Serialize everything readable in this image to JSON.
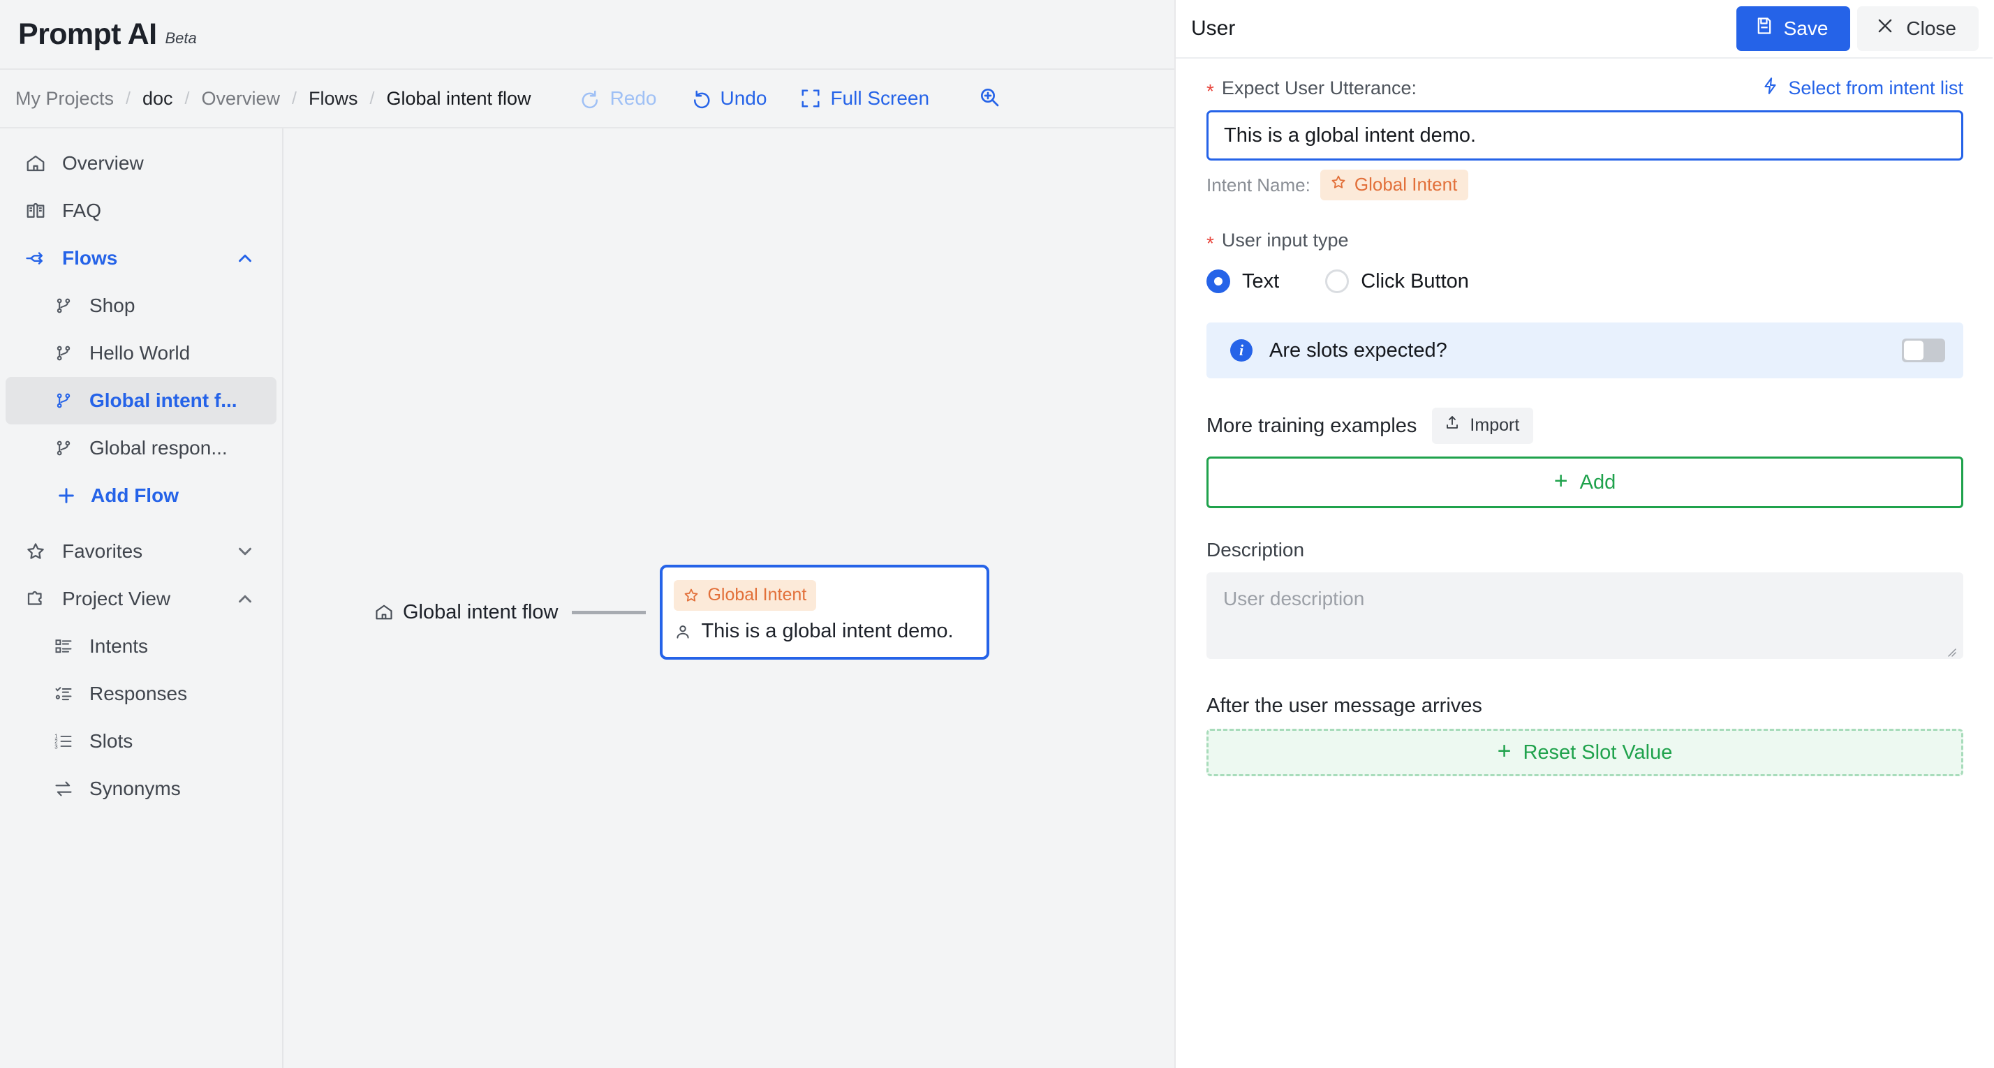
{
  "brand": {
    "name": "Prompt AI",
    "tag": "Beta"
  },
  "breadcrumb": {
    "items": [
      {
        "label": "My Projects"
      },
      {
        "label": "doc"
      },
      {
        "label": "Overview"
      },
      {
        "label": "Flows"
      },
      {
        "label": "Global intent flow"
      }
    ],
    "separator": "/"
  },
  "toolbar": {
    "redo_label": "Redo",
    "undo_label": "Undo",
    "fullscreen_label": "Full Screen",
    "zoom_icon": "zoom-in-icon"
  },
  "sidebar": {
    "items": [
      {
        "label": "Overview",
        "icon": "home-icon"
      },
      {
        "label": "FAQ",
        "icon": "book-icon"
      },
      {
        "label": "Flows",
        "icon": "flows-icon",
        "chevron": "chevron-up-icon"
      },
      {
        "label": "Shop",
        "icon": "branch-icon"
      },
      {
        "label": "Hello World",
        "icon": "branch-icon"
      },
      {
        "label": "Global intent f...",
        "icon": "branch-icon"
      },
      {
        "label": "Global respon...",
        "icon": "branch-icon"
      },
      {
        "label": "Add Flow",
        "icon": "plus-icon"
      },
      {
        "label": "Favorites",
        "icon": "star-icon",
        "chevron": "chevron-down-icon"
      },
      {
        "label": "Project View",
        "icon": "puzzle-icon",
        "chevron": "chevron-up-icon"
      },
      {
        "label": "Intents",
        "icon": "list-badge-icon"
      },
      {
        "label": "Responses",
        "icon": "list-check-icon"
      },
      {
        "label": "Slots",
        "icon": "list-number-icon"
      },
      {
        "label": "Synonyms",
        "icon": "swap-icon"
      }
    ]
  },
  "canvas": {
    "start_label": "Global intent flow",
    "start_icon": "home-icon",
    "node": {
      "badge": "Global Intent",
      "badge_icon": "star-icon",
      "utterance": "This is a global intent demo.",
      "utterance_icon": "user-icon"
    }
  },
  "panel": {
    "title": "User",
    "save_label": "Save",
    "save_icon": "save-icon",
    "close_label": "Close",
    "close_icon": "close-icon",
    "utterance_label": "Expect User Utterance:",
    "select_intent_label": "Select from intent list",
    "select_intent_icon": "lightning-icon",
    "utterance_value": "This is a global intent demo.",
    "intent_name_label": "Intent Name:",
    "intent_name_value": "Global Intent",
    "input_type_label": "User input type",
    "radio_text_label": "Text",
    "radio_button_label": "Click Button",
    "radio_selected": "Text",
    "slots_question": "Are slots expected?",
    "slots_toggle_state": "off",
    "training_label": "More training examples",
    "import_label": "Import",
    "import_icon": "upload-icon",
    "add_label": "Add",
    "description_label": "Description",
    "description_placeholder": "User description",
    "description_value": "",
    "after_label": "After the user message arrives",
    "reset_slot_label": "Reset Slot Value"
  },
  "colors": {
    "accent_blue": "#2563e8",
    "green": "#1fa24c",
    "orange": "#e2703a",
    "orange_bg": "#fcead9",
    "required_red": "#e8453c",
    "panel_info_bg": "#e8f1fd"
  }
}
